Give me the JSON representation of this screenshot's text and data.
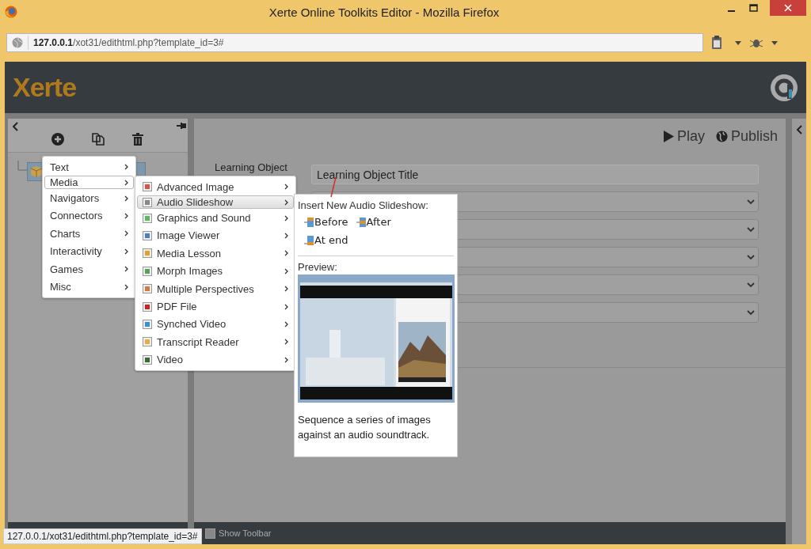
{
  "window": {
    "title": "Xerte Online Toolkits Editor - Mozilla Firefox"
  },
  "browser": {
    "url_host": "127.0.0.1",
    "url_path": "/xot31/edithtml.php?template_id=3#"
  },
  "app_header": {
    "logo": "Xerte"
  },
  "main_menu": [
    {
      "label": "Text",
      "selected": false
    },
    {
      "label": "Media",
      "selected": true
    },
    {
      "label": "Navigators",
      "selected": false
    },
    {
      "label": "Connectors",
      "selected": false
    },
    {
      "label": "Charts",
      "selected": false
    },
    {
      "label": "Interactivity",
      "selected": false
    },
    {
      "label": "Games",
      "selected": false
    },
    {
      "label": "Misc",
      "selected": false
    }
  ],
  "submenu": [
    {
      "label": "Advanced Image",
      "selected": false
    },
    {
      "label": "Audio Slideshow",
      "selected": true
    },
    {
      "label": "Graphics and Sound",
      "selected": false
    },
    {
      "label": "Image Viewer",
      "selected": false
    },
    {
      "label": "Media Lesson",
      "selected": false
    },
    {
      "label": "Morph Images",
      "selected": false
    },
    {
      "label": "Multiple Perspectives",
      "selected": false
    },
    {
      "label": "PDF File",
      "selected": false
    },
    {
      "label": "Synched Video",
      "selected": false
    },
    {
      "label": "Transcript Reader",
      "selected": false
    },
    {
      "label": "Video",
      "selected": false
    }
  ],
  "popover": {
    "heading": "Insert New Audio Slideshow:",
    "actions": [
      {
        "label": "Before"
      },
      {
        "label": "After"
      },
      {
        "label": "At end"
      }
    ],
    "preview_label": "Preview:",
    "description": "Sequence a series of images against an audio soundtrack."
  },
  "editor": {
    "toolbar": [
      {
        "label": "Play",
        "kind": "play"
      },
      {
        "label": "Publish",
        "kind": "publish"
      }
    ],
    "fields": [
      {
        "kind": "text",
        "label": "Learning Object",
        "value": "Learning Object Title"
      },
      {
        "kind": "select"
      },
      {
        "kind": "select"
      },
      {
        "kind": "select"
      },
      {
        "kind": "select"
      },
      {
        "kind": "select"
      }
    ]
  },
  "footer": {
    "show_toolbar": {
      "label": "Show Toolbar",
      "checked": false
    }
  },
  "status_url": "127.0.0.1/xot31/edithtml.php?template_id=3#"
}
